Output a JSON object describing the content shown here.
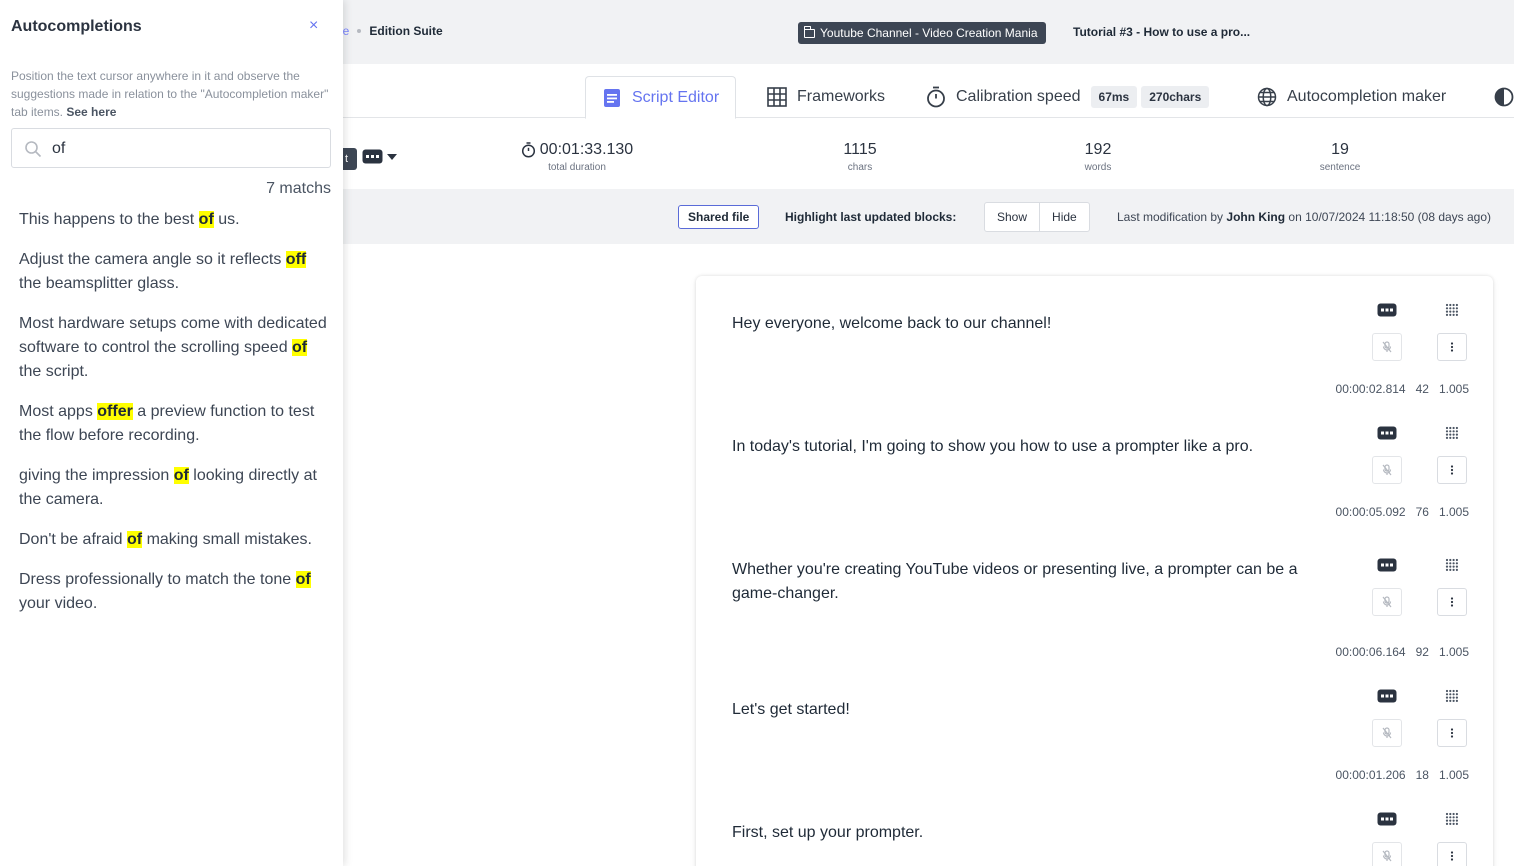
{
  "breadcrumb": {
    "home_partial": "ne",
    "current": "Edition Suite"
  },
  "header": {
    "project": "Youtube Channel - Video Creation Mania",
    "tutorial": "Tutorial #3 - How to use a pro..."
  },
  "tabs": [
    {
      "label": "Script Editor",
      "active": true
    },
    {
      "label": "Frameworks"
    },
    {
      "label": "Calibration speed",
      "speed_ms": "67ms",
      "speed_chars": "270chars"
    },
    {
      "label": "Autocompletion maker"
    }
  ],
  "stats": {
    "partial_button": "t",
    "duration": "00:01:33.130",
    "duration_label": "total duration",
    "chars": "1115",
    "chars_label": "chars",
    "words": "192",
    "words_label": "words",
    "sentences": "19",
    "sentences_label": "sentence"
  },
  "filter": {
    "shared_file": "Shared file",
    "highlight_label": "Highlight last updated blocks:",
    "show": "Show",
    "hide": "Hide",
    "last_mod_prefix": "Last modification by",
    "last_mod_user": "John King",
    "last_mod_suffix": "on 10/07/2024 11:18:50 (08 days ago)"
  },
  "script_blocks": [
    {
      "text": "Hey everyone, welcome back to our channel!",
      "time": "00:00:02.814",
      "chars": "42",
      "ratio": "1.005"
    },
    {
      "text": "In today's tutorial, I'm going to show you how to use a prompter like a pro.",
      "time": "00:00:05.092",
      "chars": "76",
      "ratio": "1.005"
    },
    {
      "text": "Whether you're creating YouTube videos or presenting live, a prompter can be a game-changer.",
      "time": "00:00:06.164",
      "chars": "92",
      "ratio": "1.005"
    },
    {
      "text": "Let's get started!",
      "time": "00:00:01.206",
      "chars": "18",
      "ratio": "1.005"
    },
    {
      "text": "First, set up your prompter.",
      "time": "",
      "chars": "",
      "ratio": ""
    }
  ],
  "panel": {
    "title": "Autocompletions",
    "close": "×",
    "help": "Position the text cursor anywhere in it and observe the suggestions made in relation to the \"Autocompletion maker\" tab items.",
    "help_link": "See here",
    "search_value": "of",
    "match_count": "7 matchs",
    "suggestions": [
      {
        "before": "This happens to the best ",
        "match": "of",
        "after": " us."
      },
      {
        "before": "Adjust the camera angle so it reflects ",
        "match": "off",
        "after": " the beamsplitter glass."
      },
      {
        "before": "Most hardware setups come with dedicated software to control the scrolling speed ",
        "match": "of",
        "after": " the script."
      },
      {
        "before": "Most apps ",
        "match": "offer",
        "after": " a preview function to test the flow before recording."
      },
      {
        "before": "giving the impression ",
        "match": "of",
        "after": " looking directly at the camera."
      },
      {
        "before": "Don't be afraid ",
        "match": "of",
        "after": " making small mistakes."
      },
      {
        "before": "Dress professionally to match the tone ",
        "match": "of",
        "after": " your video."
      }
    ]
  },
  "colors": {
    "accent": "#6574f0",
    "highlight": "#ffff00",
    "dark": "#3d4654"
  }
}
